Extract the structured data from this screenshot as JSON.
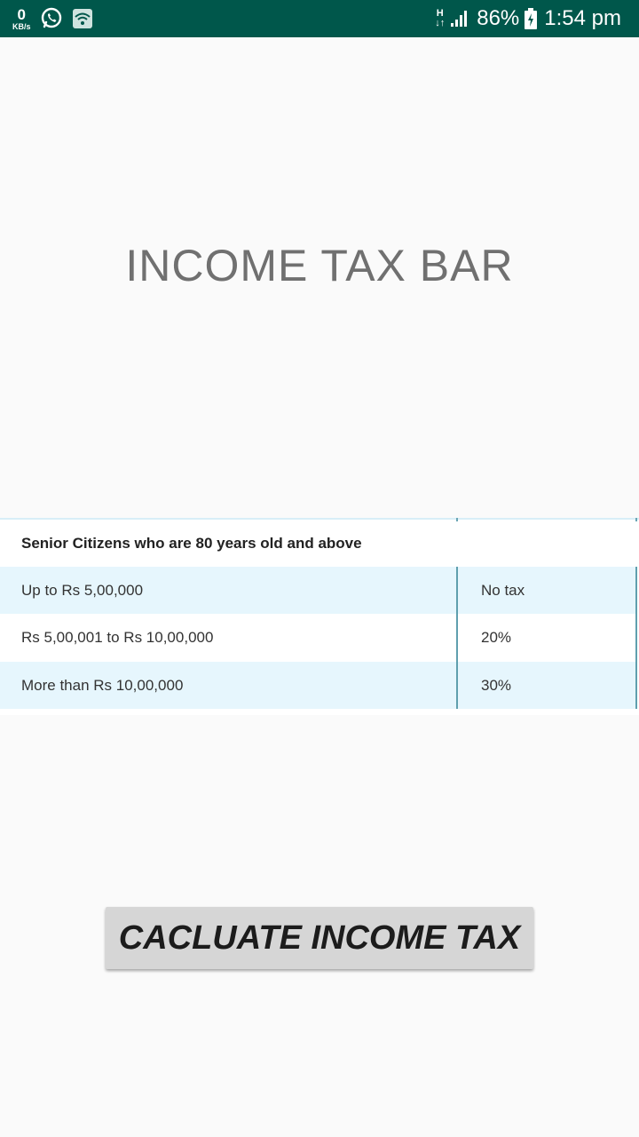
{
  "status_bar": {
    "net_speed_value": "0",
    "net_speed_unit": "KB/s",
    "network_type": "H",
    "battery_percent": "86%",
    "time": "1:54 pm",
    "icons": [
      "whatsapp-icon",
      "wifi-icon",
      "signal-icon",
      "battery-charging-icon"
    ]
  },
  "page": {
    "title": "INCOME TAX BAR"
  },
  "tax_table": {
    "heading": "Senior Citizens who are 80 years old and above",
    "rows": [
      {
        "slab": "Up to Rs 5,00,000",
        "rate": "No tax"
      },
      {
        "slab": "Rs 5,00,001 to Rs 10,00,000",
        "rate": "20%"
      },
      {
        "slab": "More than Rs 10,00,000",
        "rate": "30%"
      }
    ],
    "colors": {
      "row_alt": "#e6f6fd",
      "divider": "#5f9fae"
    }
  },
  "actions": {
    "calculate_label": "CACLUATE INCOME TAX"
  },
  "colors": {
    "status_bar": "#00574b",
    "background": "#fafafa",
    "button": "#d6d6d6"
  }
}
